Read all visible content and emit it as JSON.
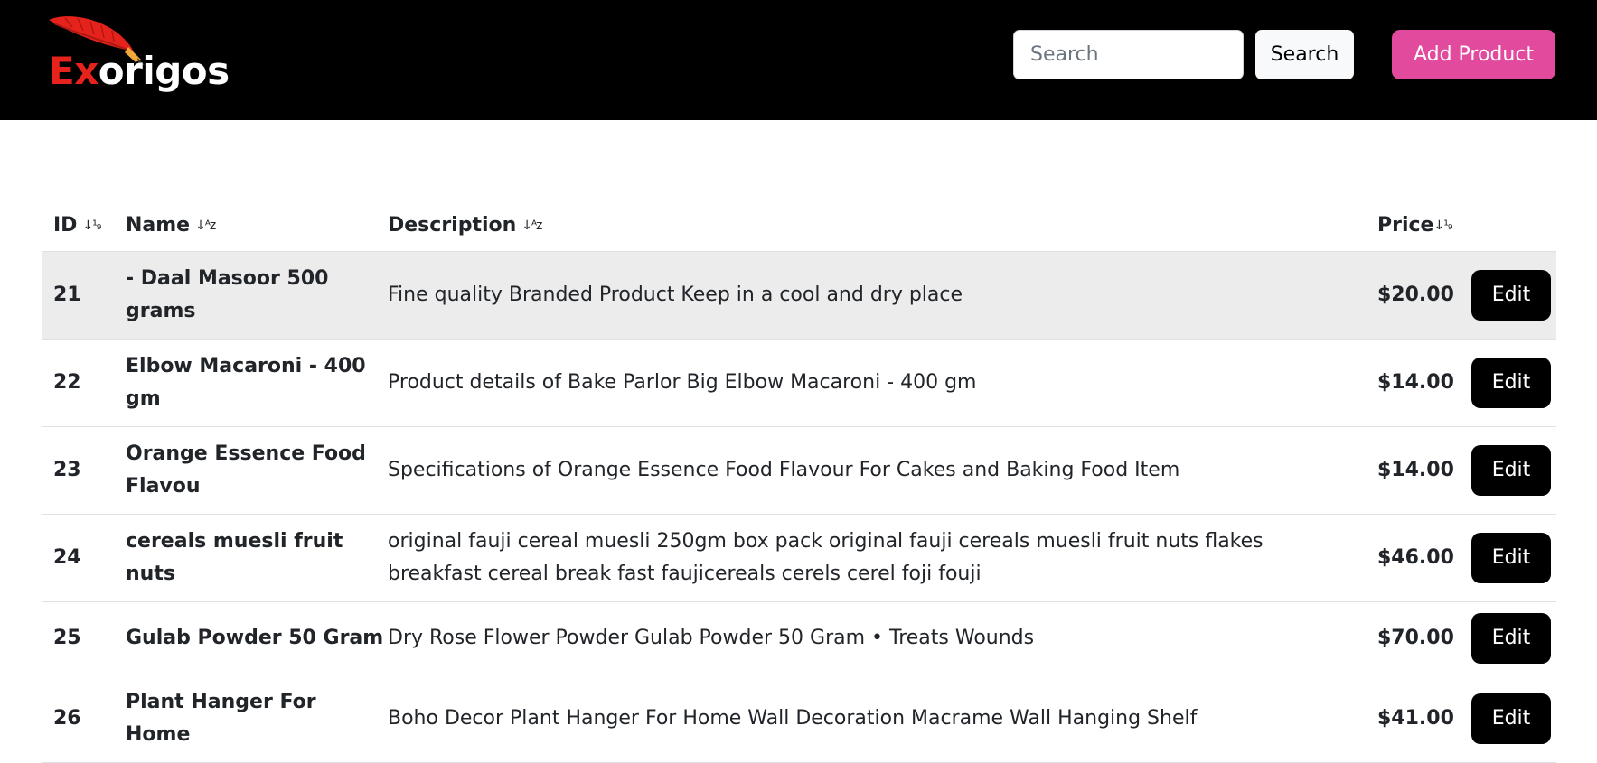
{
  "brand": {
    "logo_part1": "Ex",
    "logo_part2": "origos",
    "accent_red": "#e5231c"
  },
  "header": {
    "search_placeholder": "Search",
    "search_button": "Search",
    "add_button": "Add Product",
    "add_button_color": "#e24a9e"
  },
  "table": {
    "columns": {
      "id": "ID",
      "name": "Name",
      "description": "Description",
      "price": "Price"
    },
    "sort_icons": {
      "id": "↓¹₉",
      "name": "↓ᴬz",
      "description": "↓ᴬz",
      "price": "↓¹₉"
    },
    "edit_label": "Edit",
    "rows": [
      {
        "id": "21",
        "name": "- Daal Masoor 500 grams",
        "description": "Fine quality Branded Product Keep in a cool and dry place",
        "price": "$20.00"
      },
      {
        "id": "22",
        "name": "Elbow Macaroni - 400 gm",
        "description": "Product details of Bake Parlor Big Elbow Macaroni - 400 gm",
        "price": "$14.00"
      },
      {
        "id": "23",
        "name": "Orange Essence Food Flavou",
        "description": "Specifications of Orange Essence Food Flavour For Cakes and Baking Food Item",
        "price": "$14.00"
      },
      {
        "id": "24",
        "name": "cereals muesli fruit nuts",
        "description": "original fauji cereal muesli 250gm box pack original fauji cereals muesli fruit nuts flakes breakfast cereal break fast faujicereals cerels cerel foji fouji",
        "price": "$46.00"
      },
      {
        "id": "25",
        "name": "Gulab Powder 50 Gram",
        "description": "Dry Rose Flower Powder Gulab Powder 50 Gram • Treats Wounds",
        "price": "$70.00"
      },
      {
        "id": "26",
        "name": "Plant Hanger For Home",
        "description": "Boho Decor Plant Hanger For Home Wall Decoration Macrame Wall Hanging Shelf",
        "price": "$41.00"
      }
    ]
  }
}
